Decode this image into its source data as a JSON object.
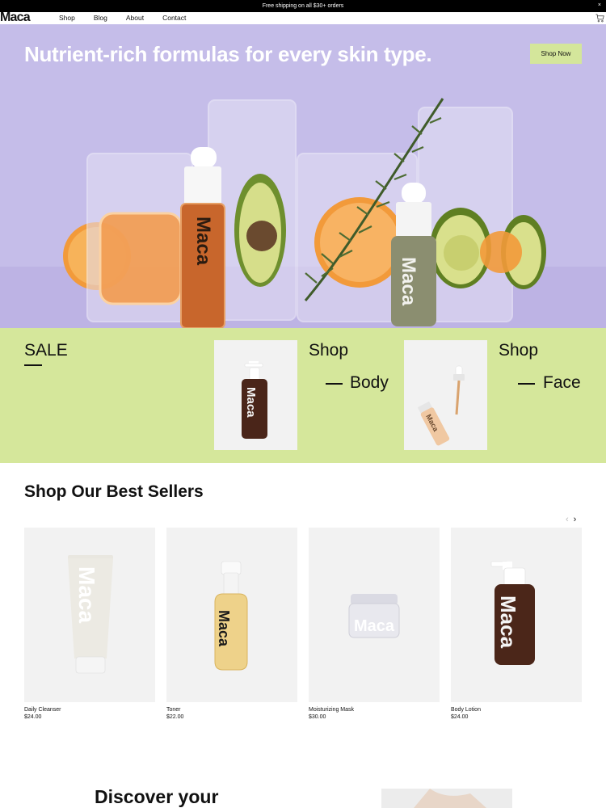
{
  "announcement": {
    "text": "Free shipping on all $30+ orders",
    "close": "×"
  },
  "header": {
    "logo": "Maca",
    "nav": [
      "Shop",
      "Blog",
      "About",
      "Contact"
    ],
    "cart_icon": "cart-icon"
  },
  "hero": {
    "title": "Nutrient-rich formulas for every skin type.",
    "button": "Shop Now",
    "bottle_brand": "Maca",
    "background": "#c5bde9",
    "accent": "#d4e69b"
  },
  "promo": {
    "background": "#d5e79b",
    "sale": "SALE",
    "shop_label": "Shop",
    "body_label": "Body",
    "face_label": "Face",
    "product_brand": "Maca"
  },
  "best_sellers": {
    "title": "Shop Our Best Sellers",
    "prev_icon": "‹",
    "next_icon": "›",
    "products": [
      {
        "name": "Daily Cleanser",
        "price": "$24.00",
        "brand": "Maca"
      },
      {
        "name": "Toner",
        "price": "$22.00",
        "brand": "Maca"
      },
      {
        "name": "Moisturizing Mask",
        "price": "$30.00",
        "brand": "Maca"
      },
      {
        "name": "Body Lotion",
        "price": "$24.00",
        "brand": "Maca"
      }
    ]
  },
  "discover": {
    "title": "Discover your"
  }
}
